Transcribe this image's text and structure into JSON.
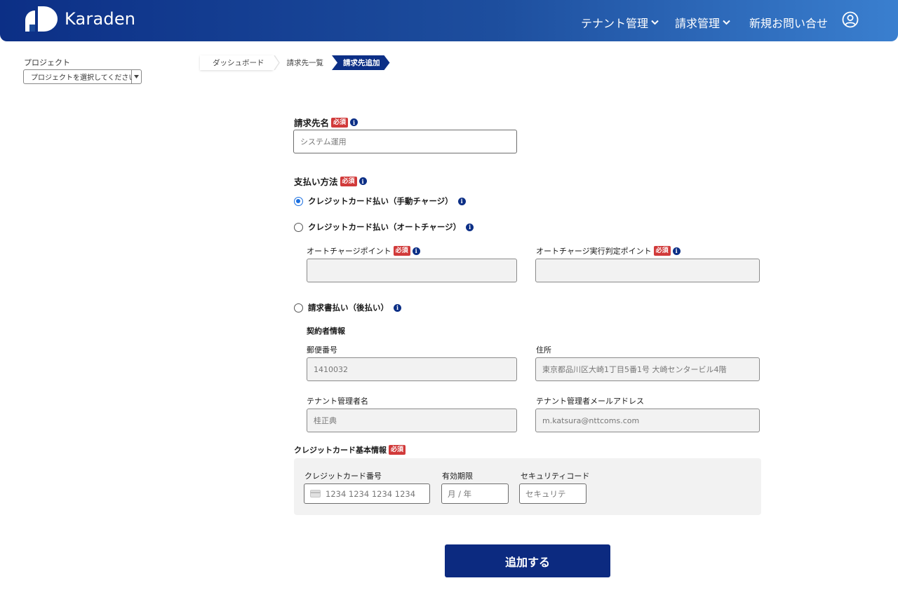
{
  "header": {
    "brand": "Karaden",
    "nav": [
      {
        "label": "テナント管理"
      },
      {
        "label": "請求管理"
      },
      {
        "label": "新規お問い合せ"
      }
    ]
  },
  "project": {
    "label": "プロジェクト",
    "placeholder": "プロジェクトを選択してください"
  },
  "breadcrumb": [
    {
      "label": "ダッシュボード"
    },
    {
      "label": "請求先一覧"
    },
    {
      "label": "請求先追加"
    }
  ],
  "form": {
    "required_badge": "必須",
    "info_glyph": "i",
    "billing_name": {
      "label": "請求先名",
      "value": "システム運用"
    },
    "payment_method": {
      "label": "支払い方法",
      "options": [
        {
          "label": "クレジットカード払い（手動チャージ）",
          "checked": true
        },
        {
          "label": "クレジットカード払い（オートチャージ）",
          "checked": false
        },
        {
          "label": "請求書払い（後払い）",
          "checked": false
        }
      ]
    },
    "auto_charge": {
      "point_label": "オートチャージポイント",
      "threshold_label": "オートチャージ実行判定ポイント"
    },
    "contractor": {
      "title": "契約者情報",
      "postal_label": "郵便番号",
      "postal_value": "1410032",
      "address_label": "住所",
      "address_value": "東京都品川区大崎1丁目5番1号 大崎センタービル4階",
      "manager_label": "テナント管理者名",
      "manager_value": "桂正典",
      "email_label": "テナント管理者メールアドレス",
      "email_value": "m.katsura@nttcoms.com"
    },
    "credit_card": {
      "title": "クレジットカード基本情報",
      "number_label": "クレジットカード番号",
      "number_placeholder": "1234 1234 1234 1234",
      "expiry_label": "有効期限",
      "expiry_placeholder": "月 / 年",
      "cvc_label": "セキュリティコード",
      "cvc_placeholder": "セキュリテ"
    },
    "submit_label": "追加する"
  },
  "colors": {
    "header_start": "#0c2f86",
    "header_end": "#3a7fcf",
    "primary": "#0c2a80",
    "required": "#d13a3a",
    "radio_selected": "#1a6fe0"
  }
}
